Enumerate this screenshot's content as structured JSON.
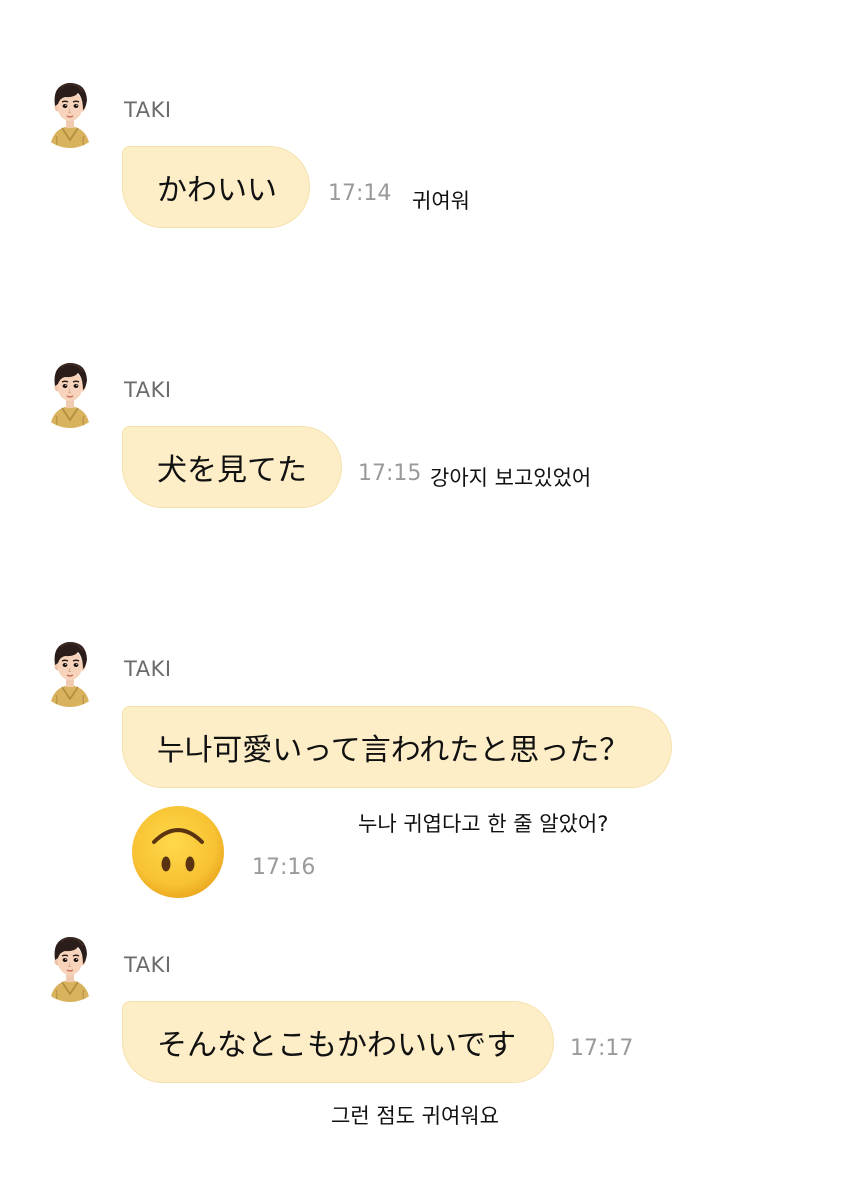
{
  "messages": [
    {
      "sender": "TAKI",
      "text": "かわいい",
      "time": "17:14",
      "translation": "귀여워"
    },
    {
      "sender": "TAKI",
      "text": "犬を見てた",
      "time": "17:15",
      "translation": "강아지 보고있었어"
    },
    {
      "sender": "TAKI",
      "text": "누나可愛いって言われたと思った？",
      "translation": "누나 귀엽다고 한 줄 알았어?",
      "emoji": "upside-down-face-emoji",
      "emoji_time": "17:16"
    },
    {
      "sender": "TAKI",
      "text": "そんなとこもかわいいです",
      "time": "17:17",
      "translation": "그런 점도 귀여워요"
    }
  ],
  "colors": {
    "bubble_bg": "#fdeec8",
    "bubble_border": "#f6e1ac",
    "time_text": "#9a9a9a",
    "sender_text": "#6b6b6b",
    "emoji_yellow": "#f7c233"
  },
  "icons": {
    "avatar": "boy-avatar-icon"
  }
}
